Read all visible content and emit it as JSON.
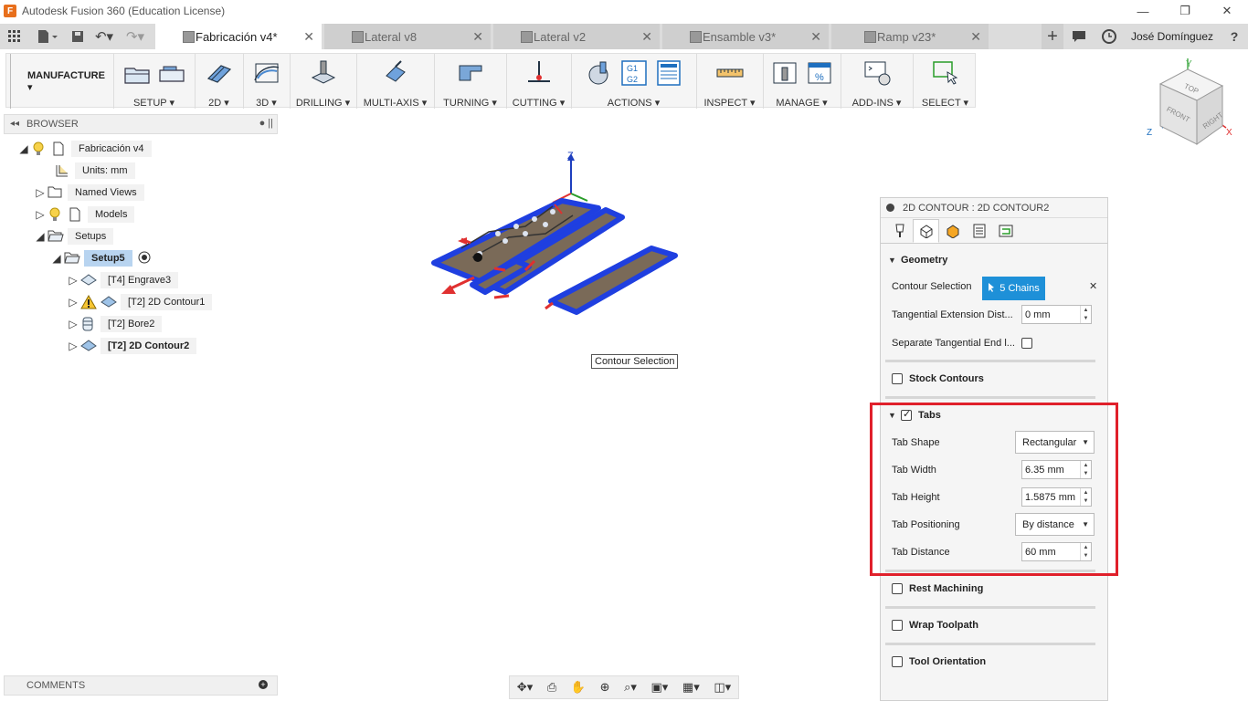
{
  "window": {
    "title": "Autodesk Fusion 360 (Education License)",
    "logo": "F",
    "minimize": "—",
    "restore": "❐",
    "close": "✕"
  },
  "doc_tabs": [
    {
      "label": "Fabricación v4*",
      "active": true
    },
    {
      "label": "Lateral v8",
      "active": false
    },
    {
      "label": "Lateral v2",
      "active": false
    },
    {
      "label": "Ensamble v3*",
      "active": false
    },
    {
      "label": "Ramp v23*",
      "active": false
    }
  ],
  "tab_close_glyph": "✕",
  "user": {
    "name": "José Domínguez",
    "help": "?"
  },
  "toolbar": {
    "workspace": "MANUFACTURE ▾",
    "groups": [
      "SETUP ▾",
      "2D ▾",
      "3D ▾",
      "DRILLING ▾",
      "MULTI-AXIS ▾",
      "TURNING ▾",
      "CUTTING ▾",
      "ACTIONS ▾",
      "INSPECT ▾",
      "MANAGE ▾",
      "ADD-INS ▾",
      "SELECT ▾"
    ]
  },
  "viewcube": {
    "top": "TOP",
    "front": "FRONT",
    "right": "RIGHT",
    "x": "X",
    "y": "Y",
    "z": "Z"
  },
  "browser": {
    "title": "BROWSER",
    "items": [
      {
        "label": "Fabricación v4"
      },
      {
        "label": "Units: mm"
      },
      {
        "label": "Named Views"
      },
      {
        "label": "Models"
      },
      {
        "label": "Setups"
      },
      {
        "label": "Setup5"
      },
      {
        "label": "[T4] Engrave3"
      },
      {
        "label": "[T2] 2D Contour1"
      },
      {
        "label": "[T2] Bore2"
      },
      {
        "label": "[T2] 2D Contour2"
      }
    ]
  },
  "viewport": {
    "tooltip": "Contour Selection",
    "axis_z": "Z"
  },
  "panel": {
    "title": "2D CONTOUR : 2D CONTOUR2",
    "geometry": {
      "header": "Geometry",
      "contour_selection": {
        "label": "Contour Selection",
        "value": "5 Chains",
        "clear": "✕"
      },
      "tangential_ext": {
        "label": "Tangential Extension Dist...",
        "value": "0 mm"
      },
      "separate_tangential": {
        "label": "Separate Tangential End l..."
      }
    },
    "stock_contours": "Stock Contours",
    "tabs": {
      "header": "Tabs",
      "tab_shape": {
        "label": "Tab Shape",
        "value": "Rectangular"
      },
      "tab_width": {
        "label": "Tab Width",
        "value": "6.35 mm"
      },
      "tab_height": {
        "label": "Tab Height",
        "value": "1.5875 mm"
      },
      "tab_positioning": {
        "label": "Tab Positioning",
        "value": "By distance"
      },
      "tab_distance": {
        "label": "Tab Distance",
        "value": "60 mm"
      }
    },
    "rest_machining": "Rest Machining",
    "wrap_toolpath": "Wrap Toolpath",
    "tool_orientation": "Tool Orientation"
  },
  "comments": {
    "title": "COMMENTS",
    "add": "+"
  },
  "navbar": [
    "✥▾",
    "⎙",
    "✋",
    "⊕",
    "⌕▾",
    "▣▾",
    "▦▾",
    "◫▾"
  ]
}
